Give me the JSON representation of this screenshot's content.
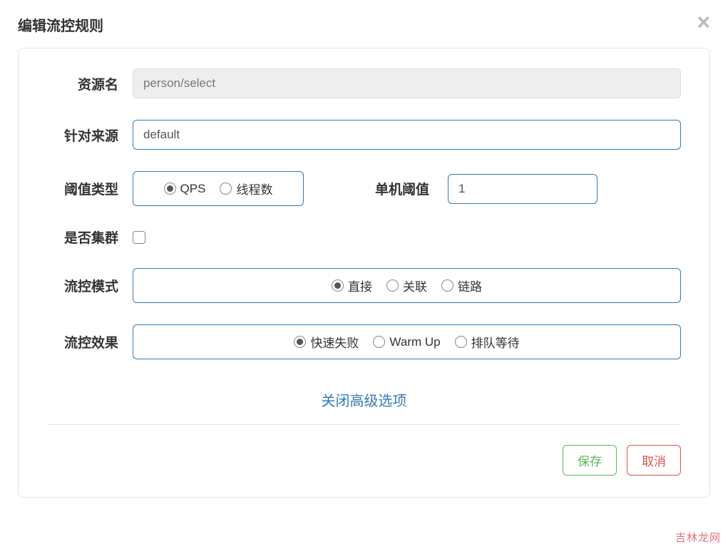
{
  "modal": {
    "title": "编辑流控规则",
    "close_symbol": "×"
  },
  "form": {
    "resource": {
      "label": "资源名",
      "value": "person/select"
    },
    "source": {
      "label": "针对来源",
      "value": "default"
    },
    "threshold_type": {
      "label": "阈值类型",
      "options": {
        "qps": "QPS",
        "threads": "线程数"
      }
    },
    "single_threshold": {
      "label": "单机阈值",
      "value": "1"
    },
    "cluster": {
      "label": "是否集群"
    },
    "flow_mode": {
      "label": "流控模式",
      "options": {
        "direct": "直接",
        "relate": "关联",
        "chain": "链路"
      }
    },
    "flow_effect": {
      "label": "流控效果",
      "options": {
        "fail_fast": "快速失败",
        "warm_up": "Warm Up",
        "queue": "排队等待"
      }
    },
    "advanced_toggle": "关闭高级选项"
  },
  "footer": {
    "save": "保存",
    "cancel": "取消"
  },
  "watermark": "吉林龙网"
}
